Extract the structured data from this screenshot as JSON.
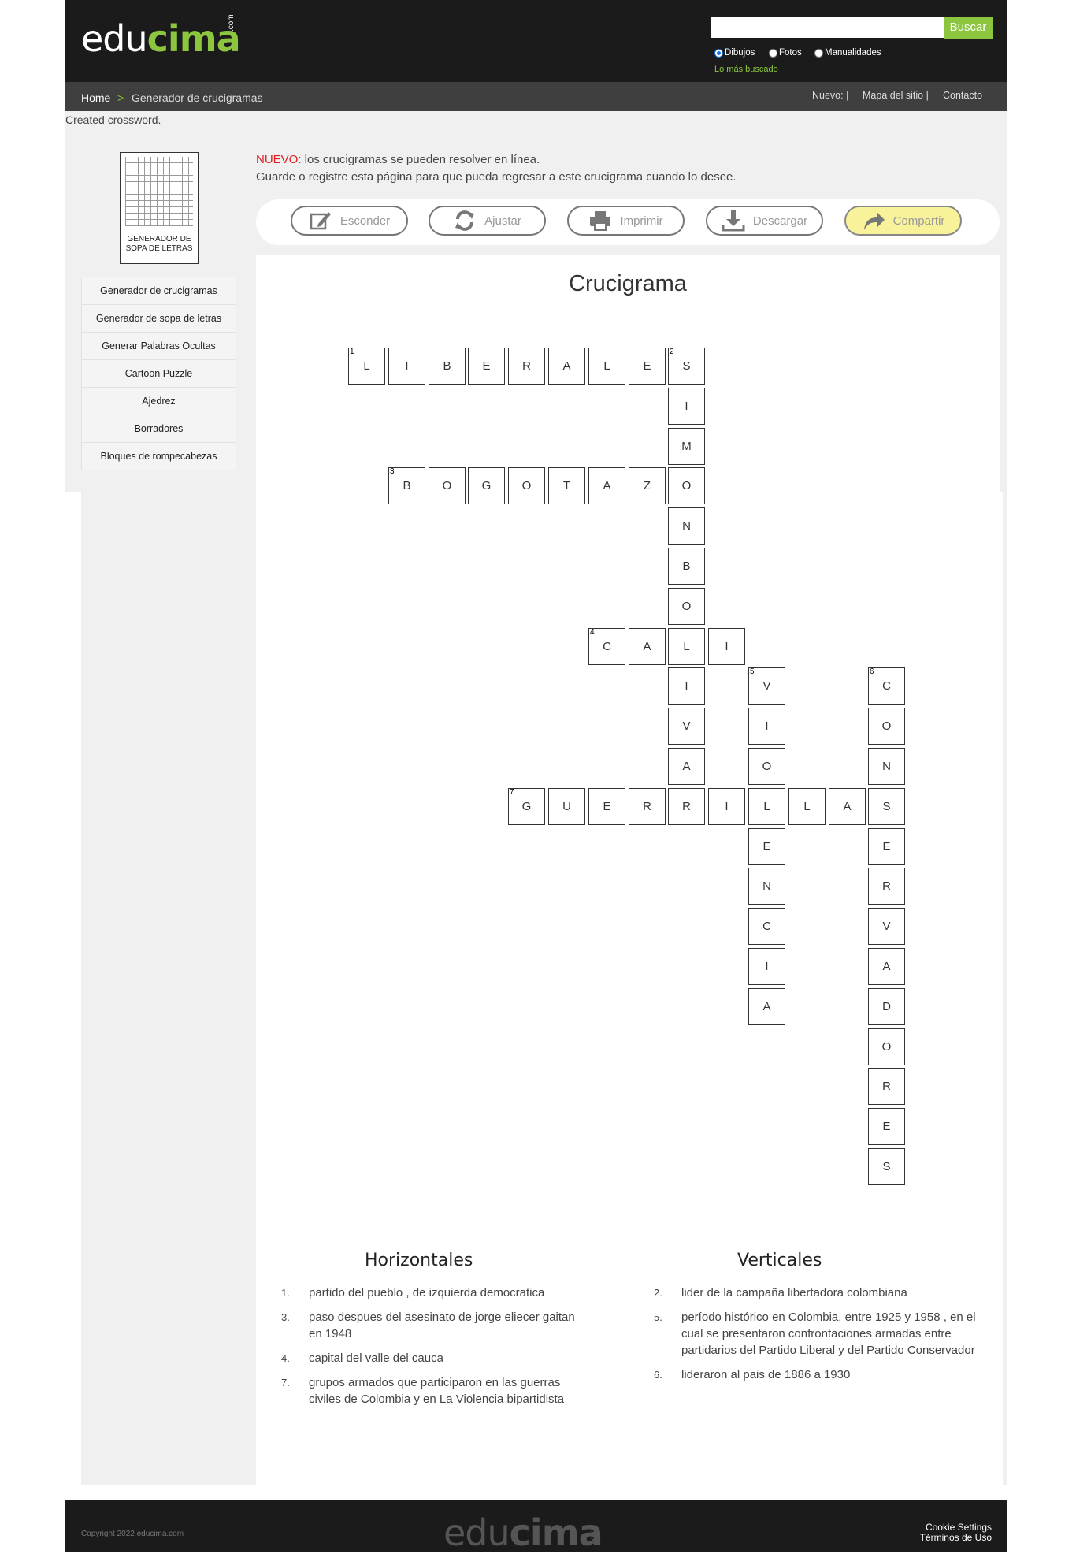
{
  "header": {
    "logo_main": "edu",
    "logo_accent": "cima",
    "logo_suffix": ".com",
    "search": {
      "placeholder": "",
      "button_label": "Buscar"
    },
    "search_types": [
      {
        "label": "Dibujos",
        "selected": true
      },
      {
        "label": "Fotos",
        "selected": false
      },
      {
        "label": "Manualidades",
        "selected": false
      }
    ],
    "most_searched": "Lo más buscado"
  },
  "breadcrumb": {
    "home": "Home",
    "separator": ">",
    "current": "Generador de crucigramas"
  },
  "top_nav": {
    "new": "Nuevo: |",
    "sitemap": "Mapa del sitio |",
    "contact": "Contacto"
  },
  "status_message": "Created crossword.",
  "sidebar": {
    "thumbnail_label": "GENERADOR DE SOPA DE LETRAS",
    "items": [
      "Generador de crucigramas",
      "Generador de sopa de letras",
      "Generar Palabras Ocultas",
      "Cartoon Puzzle",
      "Ajedrez",
      "Borradores",
      "Bloques de rompecabezas"
    ]
  },
  "notice": {
    "prefix": "NUEVO:",
    "line1": " los crucigramas se pueden resolver en línea.",
    "line2": "Guarde o registre esta página para que pueda regresar a este crucigrama cuando lo desee."
  },
  "toolbar": {
    "hide": "Esconder",
    "adjust": "Ajustar",
    "print": "Imprimir",
    "download": "Descargar",
    "share": "Compartir",
    "icons": [
      "pencil-icon",
      "refresh-icon",
      "printer-icon",
      "download-icon",
      "share-arrow-icon"
    ]
  },
  "crossword": {
    "title": "Crucigrama",
    "entries": [
      {
        "number": 1,
        "direction": "across",
        "row": 0,
        "col": 0,
        "answer": "LIBERALES"
      },
      {
        "number": 2,
        "direction": "down",
        "row": 0,
        "col": 8,
        "answer": "SIMONBOLIVAR"
      },
      {
        "number": 3,
        "direction": "across",
        "row": 3,
        "col": 1,
        "answer": "BOGOTAZO"
      },
      {
        "number": 4,
        "direction": "across",
        "row": 7,
        "col": 6,
        "answer": "CALI"
      },
      {
        "number": 5,
        "direction": "down",
        "row": 8,
        "col": 10,
        "answer": "VIOLENCIA"
      },
      {
        "number": 6,
        "direction": "down",
        "row": 8,
        "col": 13,
        "answer": "CONSERVADORES"
      },
      {
        "number": 7,
        "direction": "across",
        "row": 11,
        "col": 4,
        "answer": "GUERRILLAS"
      }
    ]
  },
  "clues": {
    "across_title": "Horizontales",
    "down_title": "Verticales",
    "across": [
      {
        "n": "1.",
        "text": "partido del pueblo , de izquierda democratica"
      },
      {
        "n": "3.",
        "text": "paso despues del asesinato de jorge eliecer gaitan en 1948"
      },
      {
        "n": "4.",
        "text": "capital del valle del cauca"
      },
      {
        "n": "7.",
        "text": "grupos armados que participaron en las guerras civiles de Colombia y en La Violencia bipartidista"
      }
    ],
    "down": [
      {
        "n": "2.",
        "text": "lider de la campaña libertadora colombiana"
      },
      {
        "n": "5.",
        "text": "período histórico en Colombia, entre 1925 y 1958 , en el cual se presentaron confrontaciones armadas entre partidarios del Partido Liberal y del Partido Conservador"
      },
      {
        "n": "6.",
        "text": "lideraron al pais de 1886 a 1930"
      }
    ]
  },
  "footer": {
    "copyright": "Copyright 2022 educima.com",
    "logo_main": "edu",
    "logo_accent": "cima",
    "logo_suffix": ".com",
    "cookie": "Cookie Settings",
    "terms": "Términos de Uso"
  }
}
